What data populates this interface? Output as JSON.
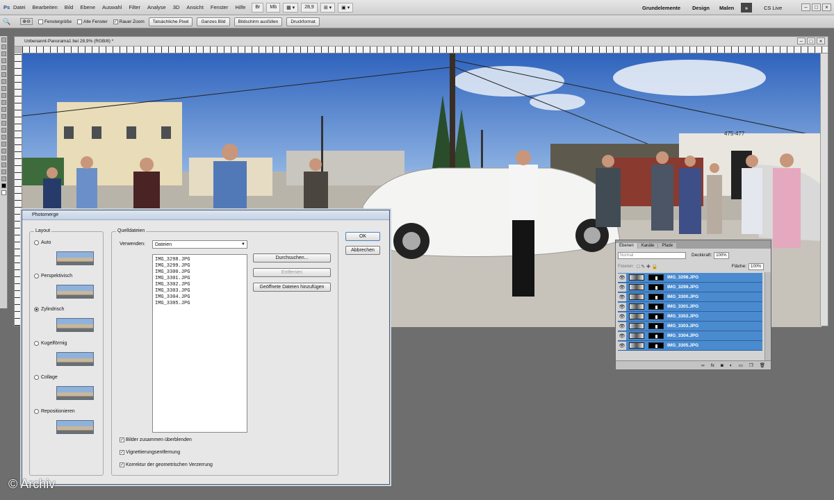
{
  "menubar": {
    "items": [
      "Datei",
      "Bearbeiten",
      "Bild",
      "Ebene",
      "Auswahl",
      "Filter",
      "Analyse",
      "3D",
      "Ansicht",
      "Fenster",
      "Hilfe"
    ],
    "zoom": "28,9",
    "workspaces": [
      "Grundelemente",
      "Design",
      "Malen"
    ],
    "cslive": "CS Live"
  },
  "options": {
    "fenstergroesse": "Fenstergröße",
    "alle_fenster": "Alle Fenster",
    "rauer_zoom": "Rauer Zoom",
    "buttons": [
      "Tatsächliche Pixel",
      "Ganzes Bild",
      "Bildschirm ausfüllen",
      "Druckformat"
    ]
  },
  "document": {
    "title": "Unbenannt-Panorama1 bei 28,9% (RGB/8) *"
  },
  "photo": {
    "sign": "475-477"
  },
  "dialog": {
    "title": "Photomerge",
    "layout_label": "Layout",
    "layouts": [
      "Auto",
      "Perspektivisch",
      "Zylindrisch",
      "Kugelförmig",
      "Collage",
      "Repositionieren"
    ],
    "source_label": "Quelldateien",
    "use_label": "Verwenden:",
    "use_value": "Dateien",
    "files": [
      "IMG_3298.JPG",
      "IMG_3299.JPG",
      "IMG_3300.JPG",
      "IMG_3301.JPG",
      "IMG_3302.JPG",
      "IMG_3303.JPG",
      "IMG_3304.JPG",
      "IMG_3305.JPG"
    ],
    "browse": "Durchsuchen...",
    "remove": "Entfernen",
    "add_open": "Geöffnete Dateien hinzufügen",
    "ok": "OK",
    "cancel": "Abbrechen",
    "checks": [
      "Bilder zusammen überblenden",
      "Vignettierungsentfernung",
      "Korrektur der geometrischen Verzerrung"
    ]
  },
  "layers": {
    "tabs": [
      "Ebenen",
      "Kanäle",
      "Pfade"
    ],
    "blend": "Normal",
    "opacity_label": "Deckkraft:",
    "opacity": "100%",
    "lock_label": "Fixieren:",
    "fill_label": "Fläche:",
    "fill": "100%",
    "items": [
      "IMG_3298.JPG",
      "IMG_3299.JPG",
      "IMG_3300.JPG",
      "IMG_3301.JPG",
      "IMG_3302.JPG",
      "IMG_3303.JPG",
      "IMG_3304.JPG",
      "IMG_3305.JPG"
    ],
    "footer_icons": [
      "link-icon",
      "fx-icon",
      "mask-icon",
      "adjustment-icon",
      "folder-icon",
      "new-layer-icon",
      "trash-icon"
    ]
  },
  "copyright": "© Archiv"
}
